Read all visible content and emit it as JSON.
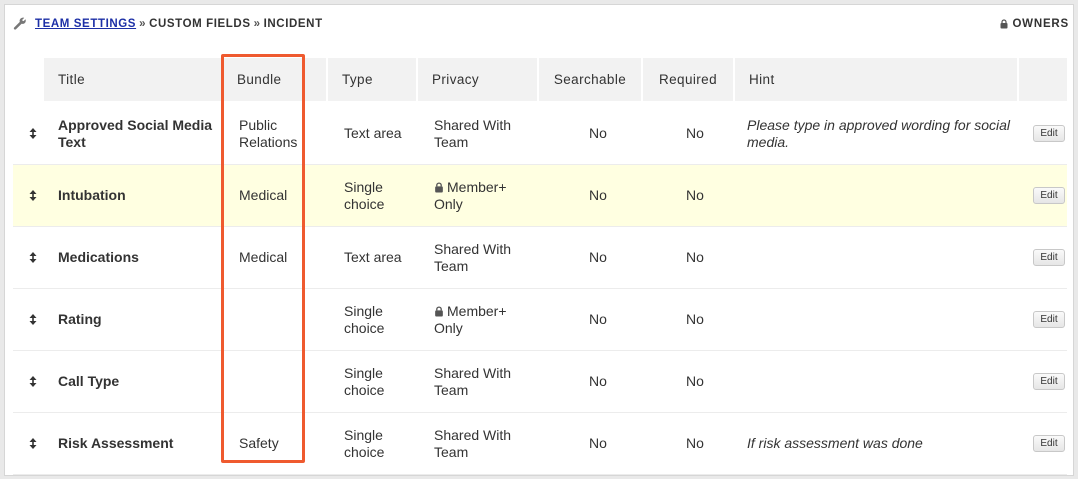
{
  "breadcrumb": {
    "team_settings": "TEAM SETTINGS",
    "sep1": "»",
    "custom_fields": "CUSTOM FIELDS",
    "sep2": "»",
    "incident": "INCIDENT"
  },
  "owners_label": "OWNERS",
  "columns": {
    "title": "Title",
    "bundle": "Bundle",
    "type": "Type",
    "privacy": "Privacy",
    "searchable": "Searchable",
    "required": "Required",
    "hint": "Hint"
  },
  "rows": [
    {
      "title": "Approved Social Media Text",
      "bundle": "Public Relations",
      "type": "Text area",
      "privacy": "Shared With Team",
      "privacy_locked": false,
      "searchable": "No",
      "required": "No",
      "hint": "Please type in approved wording for social media.",
      "edit": "Edit",
      "highlighted": false
    },
    {
      "title": "Intubation",
      "bundle": "Medical",
      "type": "Single choice",
      "privacy": "Member+ Only",
      "privacy_locked": true,
      "searchable": "No",
      "required": "No",
      "hint": "",
      "edit": "Edit",
      "highlighted": true
    },
    {
      "title": "Medications",
      "bundle": "Medical",
      "type": "Text area",
      "privacy": "Shared With Team",
      "privacy_locked": false,
      "searchable": "No",
      "required": "No",
      "hint": "",
      "edit": "Edit",
      "highlighted": false
    },
    {
      "title": "Rating",
      "bundle": "",
      "type": "Single choice",
      "privacy": "Member+ Only",
      "privacy_locked": true,
      "searchable": "No",
      "required": "No",
      "hint": "",
      "edit": "Edit",
      "highlighted": false
    },
    {
      "title": "Call Type",
      "bundle": "",
      "type": "Single choice",
      "privacy": "Shared With Team",
      "privacy_locked": false,
      "searchable": "No",
      "required": "No",
      "hint": "",
      "edit": "Edit",
      "highlighted": false
    },
    {
      "title": "Risk Assessment",
      "bundle": "Safety",
      "type": "Single choice",
      "privacy": "Shared With Team",
      "privacy_locked": false,
      "searchable": "No",
      "required": "No",
      "hint": "If risk assessment was done",
      "edit": "Edit",
      "highlighted": false
    }
  ],
  "colors": {
    "link": "#1c2fa6",
    "highlight_row": "#ffffe1",
    "annotation_box": "#ef5a2f",
    "header_bg": "#f2f2f2"
  },
  "icons": {
    "header": "wrench-icon",
    "owners": "lock-icon",
    "drag": "drag-handle-icon",
    "privacy": "lock-icon"
  }
}
